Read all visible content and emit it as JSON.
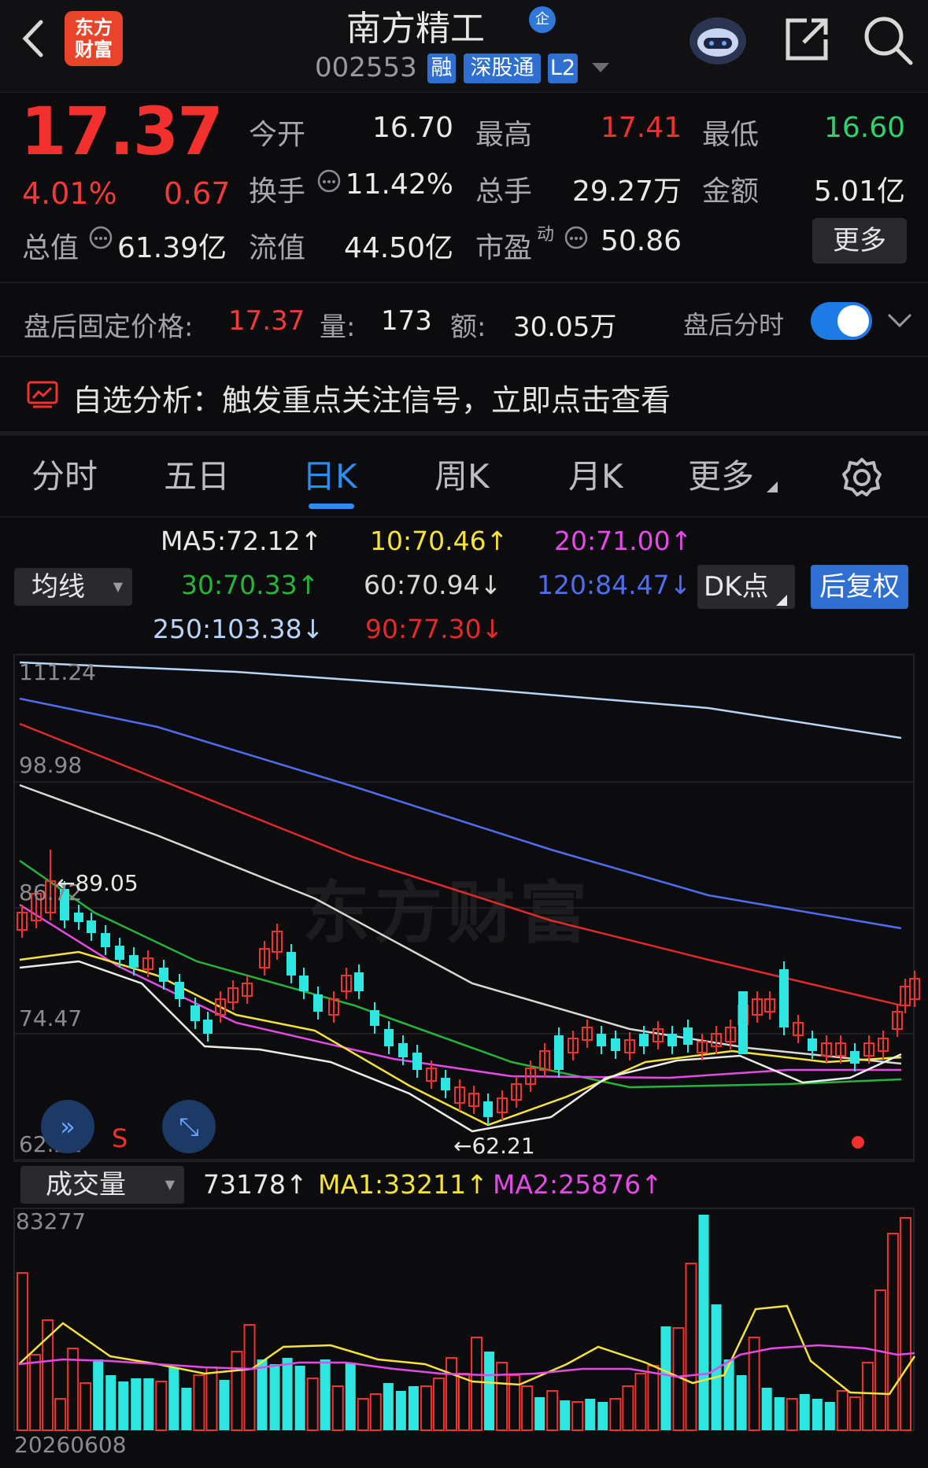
{
  "header": {
    "logo": "东方财富",
    "title": "南方精工",
    "qi_badge": "企",
    "code": "002553",
    "tags": [
      "融",
      "深股通",
      "L2"
    ]
  },
  "quote": {
    "price": "17.37",
    "change_pct": "4.01%",
    "change_amt": "0.67",
    "fields": [
      {
        "label": "今开",
        "value": "16.70"
      },
      {
        "label": "最高",
        "value": "17.41"
      },
      {
        "label": "最低",
        "value": "16.60"
      },
      {
        "label": "换手",
        "value": "11.42%"
      },
      {
        "label": "总手",
        "value": "29.27万"
      },
      {
        "label": "金额",
        "value": "5.01亿"
      },
      {
        "label": "总值",
        "value": "61.39亿"
      },
      {
        "label": "流值",
        "value": "44.50亿"
      },
      {
        "label": "市盈",
        "value": "50.86"
      }
    ],
    "pe_sup": "动",
    "more": "更多"
  },
  "afterhours": {
    "label": "盘后固定价格:",
    "price": "17.37",
    "vol_label": "量:",
    "vol": "173",
    "amt_label": "额:",
    "amt": "30.05万",
    "toggle_label": "盘后分时",
    "toggle_on": true
  },
  "analysis": {
    "text": "自选分析：触发重点关注信号，立即点击查看"
  },
  "tabs": [
    "分时",
    "五日",
    "日K",
    "周K",
    "月K",
    "更多"
  ],
  "active_tab": "日K",
  "ma": {
    "dropdown": "均线",
    "items": [
      {
        "text": "MA5:72.12↑",
        "color": "#e8e8e8"
      },
      {
        "text": "10:70.46↑",
        "color": "#f5e23a"
      },
      {
        "text": "20:71.00↑",
        "color": "#e54ae6"
      },
      {
        "text": "30:70.33↑",
        "color": "#25b53a"
      },
      {
        "text": "60:70.94↓",
        "color": "#d8d8d8"
      },
      {
        "text": "120:84.47↓",
        "color": "#4f6df0"
      },
      {
        "text": "250:103.38↓",
        "color": "#b9d5f5"
      },
      {
        "text": "90:77.30↓",
        "color": "#e12a2a"
      }
    ],
    "dk": "DK点",
    "adjust": "后复权"
  },
  "chart_axes": {
    "y_ticks": [
      "111.24",
      "98.98",
      "86.72",
      "74.47",
      "62.21"
    ],
    "high_marker": "89.05",
    "low_marker": "62.21",
    "sell_marker": "S"
  },
  "volume": {
    "dropdown": "成交量",
    "value": "73178↑",
    "ma1": "MA1:33211↑",
    "ma2": "MA2:25876↑",
    "top": "83277",
    "date": "20260608"
  },
  "watermark": "东方财富",
  "colors": {
    "up": "#f2302d",
    "down": "#2fd36d",
    "accent": "#2d8cf0"
  }
}
